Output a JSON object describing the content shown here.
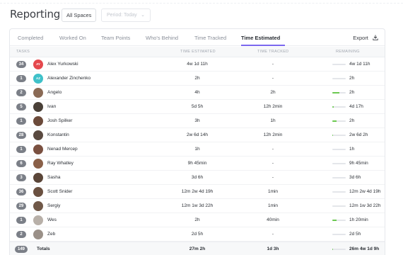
{
  "header": {
    "title": "Reporting",
    "spaces_button": "All Spaces",
    "period_button": "Period: Today",
    "period_chevron": "chevron-down-icon"
  },
  "tabs": [
    {
      "label": "Completed",
      "active": false
    },
    {
      "label": "Worked On",
      "active": false
    },
    {
      "label": "Team Points",
      "active": false
    },
    {
      "label": "Who's Behind",
      "active": false
    },
    {
      "label": "Time Tracked",
      "active": false
    },
    {
      "label": "Time Estimated",
      "active": true
    }
  ],
  "export": {
    "label": "Export",
    "icon": "download-icon"
  },
  "columns": {
    "tasks": "TASKS",
    "estimated": "TIME ESTIMATED",
    "tracked": "TIME TRACKED",
    "remaining": "REMAINING"
  },
  "colors": {
    "accent": "#7b68ee",
    "progress": "#6bc950",
    "badge": "#7b7f87"
  },
  "rows": [
    {
      "count": "34",
      "name": "Alex Yurkowski",
      "initials": "AY",
      "avatar_color": "#e5484d",
      "estimated": "4w 1d 11h",
      "tracked": "-",
      "remaining": "4w 1d 11h",
      "progress": 0
    },
    {
      "count": "1",
      "name": "Alexander Zinchenko",
      "initials": "AZ",
      "avatar_color": "#3fc1c9",
      "estimated": "2h",
      "tracked": "-",
      "remaining": "2h",
      "progress": 0
    },
    {
      "count": "2",
      "name": "Angelo",
      "initials": "",
      "avatar_color": "#8a6a55",
      "estimated": "4h",
      "tracked": "2h",
      "remaining": "2h",
      "progress": 0.5
    },
    {
      "count": "5",
      "name": "Ivan",
      "initials": "",
      "avatar_color": "#4a4038",
      "estimated": "5d 5h",
      "tracked": "12h 2min",
      "remaining": "4d 17h",
      "progress": 0.1
    },
    {
      "count": "1",
      "name": "Josh Spilker",
      "initials": "",
      "avatar_color": "#6b4a3a",
      "estimated": "3h",
      "tracked": "1h",
      "remaining": "2h",
      "progress": 0.33
    },
    {
      "count": "28",
      "name": "Konstantin",
      "initials": "",
      "avatar_color": "#5a4a40",
      "estimated": "2w 6d 14h",
      "tracked": "12h 2min",
      "remaining": "2w 6d 2h",
      "progress": 0.04
    },
    {
      "count": "1",
      "name": "Nenad Mercep",
      "initials": "",
      "avatar_color": "#7a5040",
      "estimated": "1h",
      "tracked": "-",
      "remaining": "1h",
      "progress": 0
    },
    {
      "count": "6",
      "name": "Ray Whatley",
      "initials": "",
      "avatar_color": "#8a6048",
      "estimated": "9h 45min",
      "tracked": "-",
      "remaining": "9h 45min",
      "progress": 0
    },
    {
      "count": "3",
      "name": "Sasha",
      "initials": "",
      "avatar_color": "#5a4538",
      "estimated": "3d 6h",
      "tracked": "-",
      "remaining": "3d 6h",
      "progress": 0
    },
    {
      "count": "36",
      "name": "Scott Snider",
      "initials": "",
      "avatar_color": "#6a5040",
      "estimated": "12m 2w 4d 19h",
      "tracked": "1min",
      "remaining": "12m 2w 4d 19h",
      "progress": 0
    },
    {
      "count": "29",
      "name": "Sergiy",
      "initials": "",
      "avatar_color": "#705848",
      "estimated": "12m 1w 3d 22h",
      "tracked": "1min",
      "remaining": "12m 1w 3d 22h",
      "progress": 0
    },
    {
      "count": "1",
      "name": "Wes",
      "initials": "",
      "avatar_color": "#b8b0a8",
      "estimated": "2h",
      "tracked": "40min",
      "remaining": "1h 20min",
      "progress": 0.33
    },
    {
      "count": "2",
      "name": "Zeb",
      "initials": "",
      "avatar_color": "#9a9088",
      "estimated": "2d 5h",
      "tracked": "-",
      "remaining": "2d 5h",
      "progress": 0
    }
  ],
  "totals": {
    "count": "149",
    "label": "Totals",
    "estimated": "27m 2h",
    "tracked": "1d 3h",
    "remaining": "26m 4w 1d 9h",
    "progress": 0.05
  }
}
